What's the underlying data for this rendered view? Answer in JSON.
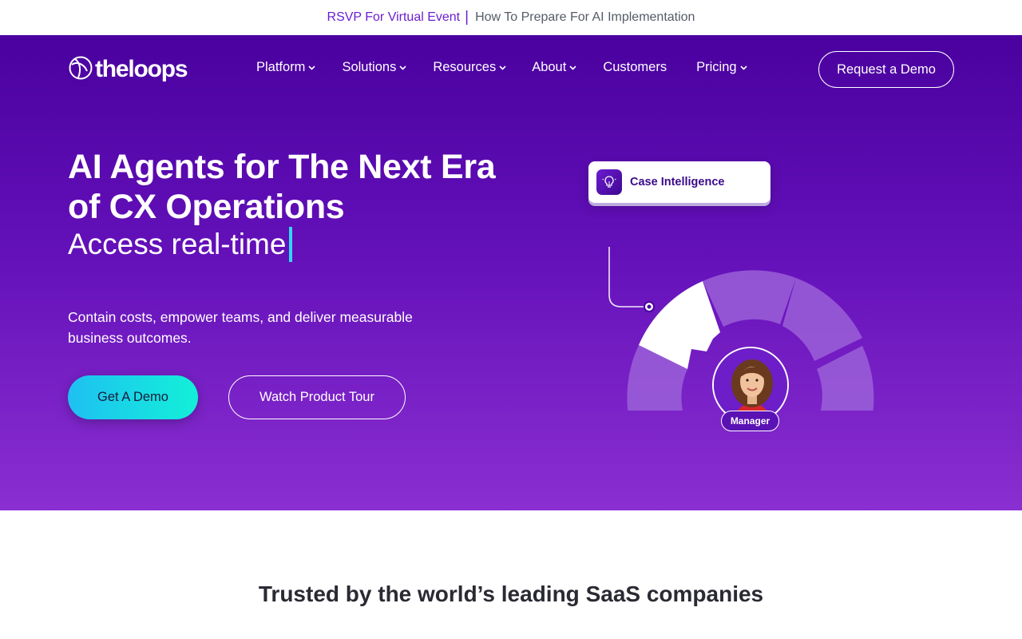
{
  "announcement": {
    "event_link": "RSVP For Virtual Event",
    "divider": "|",
    "event_title": "How To Prepare For AI Implementation"
  },
  "nav": {
    "logo": "theloops",
    "items": [
      {
        "label": "Platform",
        "has_dropdown": true
      },
      {
        "label": "Solutions",
        "has_dropdown": true
      },
      {
        "label": "Resources",
        "has_dropdown": true
      },
      {
        "label": "About",
        "has_dropdown": true
      },
      {
        "label": "Customers",
        "has_dropdown": false
      },
      {
        "label": "Pricing",
        "has_dropdown": true
      }
    ],
    "cta": "Request a Demo"
  },
  "hero": {
    "headline": "AI Agents for The Next Era of CX Operations",
    "typed_text": "Access real-time",
    "subcopy": "Contain costs, empower teams, and deliver measurable business outcomes.",
    "primary_cta": "Get A Demo",
    "secondary_cta": "Watch Product Tour"
  },
  "illustration": {
    "card_label": "Case Intelligence",
    "card_icon": "lightbulb-icon",
    "badge_label": "Manager"
  },
  "trusted": {
    "heading": "Trusted by the world’s leading SaaS companies"
  },
  "colors": {
    "hero_top": "#4a019f",
    "hero_bottom": "#8a2fd1",
    "accent_purple": "#6a1fd0",
    "cta_cyan": "#1fc0f2",
    "cta_teal": "#12f0d8",
    "caret": "#31d7f0"
  }
}
